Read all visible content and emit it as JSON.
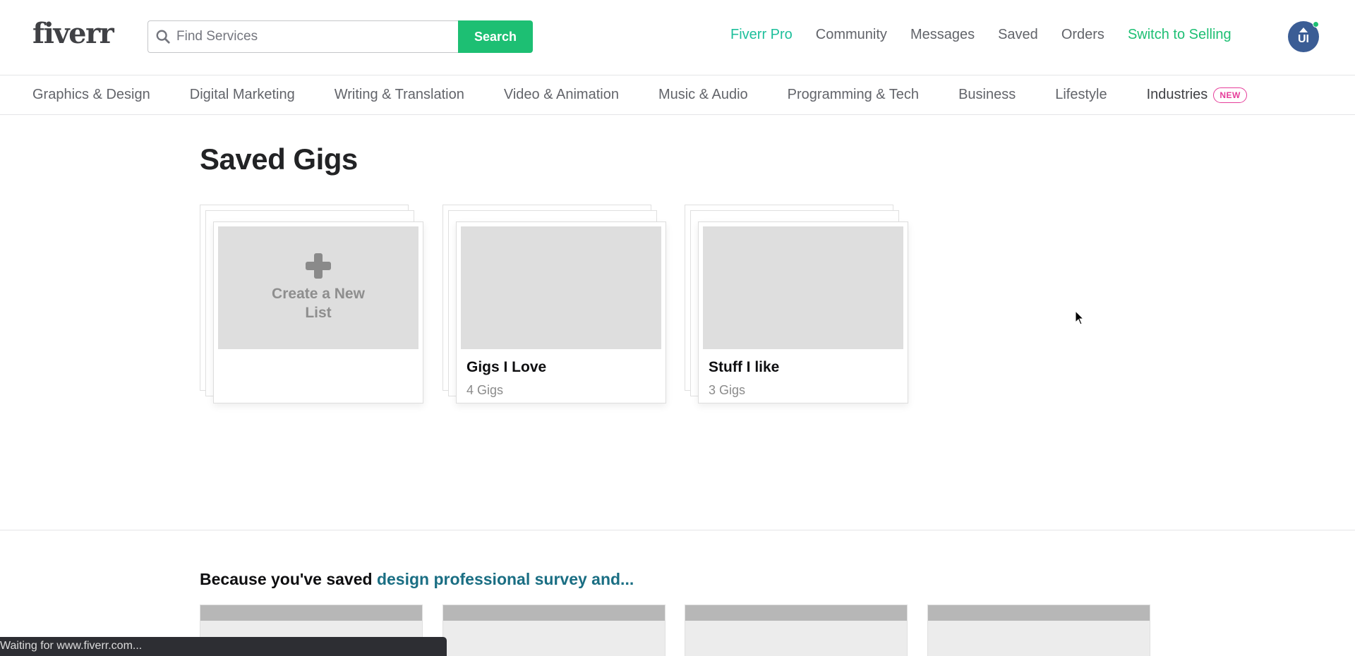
{
  "header": {
    "logo": "fiverr",
    "search": {
      "placeholder": "Find Services",
      "value": "",
      "button_label": "Search"
    },
    "nav": [
      {
        "label": "Fiverr Pro",
        "style": "pro"
      },
      {
        "label": "Community"
      },
      {
        "label": "Messages"
      },
      {
        "label": "Saved"
      },
      {
        "label": "Orders"
      },
      {
        "label": "Switch to Selling",
        "style": "sell"
      }
    ],
    "avatar": {
      "initials": "UI",
      "online": true,
      "color": "#3b5d95"
    }
  },
  "categories": [
    "Graphics & Design",
    "Digital Marketing",
    "Writing & Translation",
    "Video & Animation",
    "Music & Audio",
    "Programming & Tech",
    "Business",
    "Lifestyle",
    "Industries"
  ],
  "categories_badge": "NEW",
  "main": {
    "title": "Saved Gigs",
    "create_list_label": "Create a New List",
    "lists": [
      {
        "name": "Gigs I Love",
        "count": "4 Gigs"
      },
      {
        "name": "Stuff I like",
        "count": "3 Gigs"
      }
    ]
  },
  "recommendations": {
    "prefix": "Because you've saved ",
    "link": "design professional survey and..."
  },
  "status_bar": "Waiting for www.fiverr.com...",
  "colors": {
    "brand_green": "#1dbf73",
    "pro_teal": "#1dbf9b",
    "link_teal": "#1a6e83",
    "new_badge": "#e63d9a"
  }
}
